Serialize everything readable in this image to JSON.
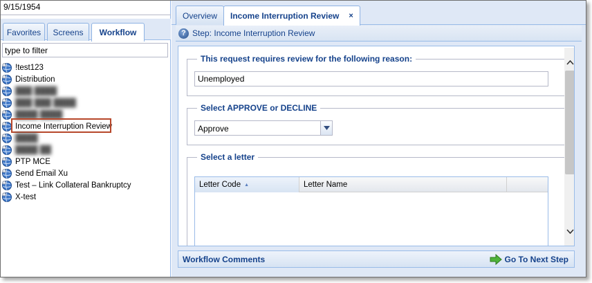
{
  "left_panel": {
    "date_value": "9/15/1954",
    "tabs": [
      {
        "label": "Favorites",
        "active": false
      },
      {
        "label": "Screens",
        "active": false
      },
      {
        "label": "Workflow",
        "active": true
      }
    ],
    "filter_placeholder": "type to filter",
    "tree_items": [
      {
        "label": "!test123",
        "blurred": false
      },
      {
        "label": "Distribution",
        "blurred": false
      },
      {
        "label": "███ ████",
        "blurred": true
      },
      {
        "label": "███ ███ ████",
        "blurred": true
      },
      {
        "label": "████ ████",
        "blurred": true
      },
      {
        "label": "Income Interruption Review",
        "blurred": false,
        "highlighted": true
      },
      {
        "label": "████",
        "blurred": true
      },
      {
        "label": "████ ██",
        "blurred": true
      },
      {
        "label": "PTP MCE",
        "blurred": false
      },
      {
        "label": "Send Email Xu",
        "blurred": false
      },
      {
        "label": "Test – Link Collateral Bankruptcy",
        "blurred": false
      },
      {
        "label": "X-test",
        "blurred": false
      }
    ],
    "tree_icon": "gear-globe-icon",
    "highlight_color": "#b7472a"
  },
  "right_panel": {
    "tabs": [
      {
        "label": "Overview",
        "active": false
      },
      {
        "label": "Income Interruption Review",
        "active": true,
        "closable": true
      }
    ],
    "close_glyph": "×",
    "step_label": "Step: Income Interruption Review",
    "sections": {
      "reason": {
        "legend": "This request requires review for the following reason:",
        "value": "Unemployed"
      },
      "decision": {
        "legend": "Select APPROVE or DECLINE",
        "selected": "Approve"
      },
      "letter": {
        "legend": "Select a letter",
        "columns": [
          "Letter Code",
          "Letter Name"
        ],
        "sorted_column": "Letter Code",
        "rows": []
      }
    },
    "footer": {
      "title": "Workflow Comments",
      "next_button": "Go To Next Step"
    }
  },
  "colors": {
    "header_text": "#15428b",
    "panel_bg": "#dfe8f6",
    "border": "#99bbe8"
  }
}
